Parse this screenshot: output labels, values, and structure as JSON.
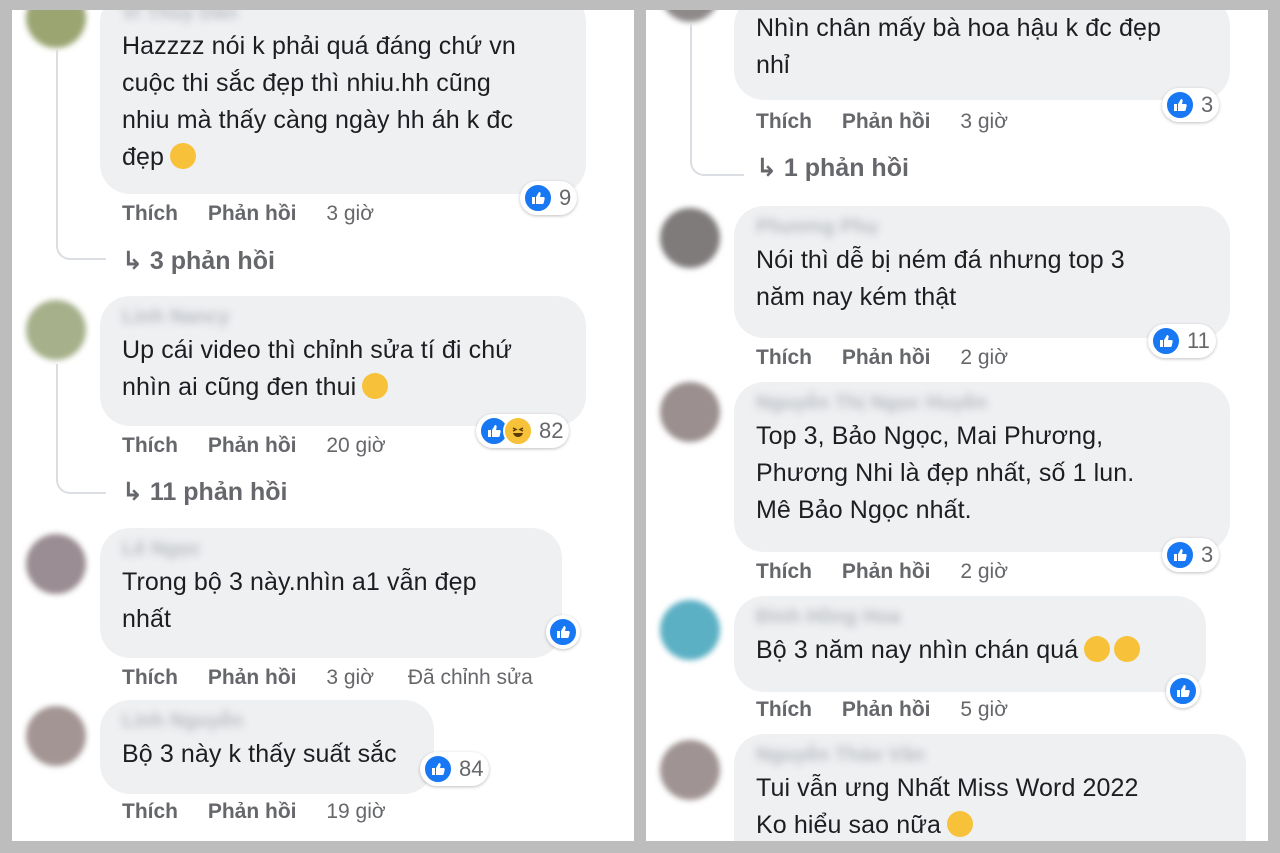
{
  "colors": {
    "like_blue": "#1877f2",
    "bubble_bg": "#eff0f2",
    "meta_gray": "#65676b"
  },
  "left_column": {
    "comments": [
      {
        "author": "Vi Thùy Dân",
        "text": "Hazzzz nói k phải quá đáng chứ vn\ncuộc thi sắc đẹp thì nhiu.hh cũng\nnhiu mà thấy càng ngày hh áh k đc\nđẹp",
        "emoji": "laughing-with-tears-emoji",
        "reaction_count": "9",
        "like_label": "Thích",
        "reply_label": "Phản hồi",
        "time": "3 giờ",
        "replies": "3 phản hồi"
      },
      {
        "author": "Linh Nancy",
        "text": "Up cái video thì chỉnh sửa tí đi chứ\nnhìn ai cũng đen thui",
        "emoji": "hugging-emoji",
        "reaction_count": "82",
        "like_label": "Thích",
        "reply_label": "Phản hồi",
        "time": "20 giờ",
        "replies": "11 phản hồi"
      },
      {
        "author": "Lê Ngọc",
        "text": "Trong bộ 3 này.nhìn a1 vẫn đẹp\nnhất",
        "reaction_count": "",
        "like_label": "Thích",
        "reply_label": "Phản hồi",
        "time": "3 giờ",
        "edited": "Đã chỉnh sửa"
      },
      {
        "author": "Linh Nguyễn",
        "text": "Bộ 3 này k thấy suất sắc",
        "reaction_count": "84",
        "like_label": "Thích",
        "reply_label": "Phản hồi",
        "time": "19 giờ"
      }
    ]
  },
  "right_column": {
    "comments": [
      {
        "text": "Nhìn chân mấy bà hoa hậu k đc đẹp\nnhỉ",
        "reaction_count": "3",
        "like_label": "Thích",
        "reply_label": "Phản hồi",
        "time": "3 giờ",
        "replies": "1 phản hồi"
      },
      {
        "author": "Phương Phụ",
        "text": "Nói thì dễ bị ném đá nhưng top 3\nnăm nay kém thật",
        "reaction_count": "11",
        "like_label": "Thích",
        "reply_label": "Phản hồi",
        "time": "2 giờ"
      },
      {
        "author": "Nguyễn Thị Ngọc Huyền",
        "text": "Top 3, Bảo Ngọc, Mai Phương,\nPhương Nhi là đẹp nhất, số 1 lun.\nMê Bảo Ngọc nhất.",
        "reaction_count": "3",
        "like_label": "Thích",
        "reply_label": "Phản hồi",
        "time": "2 giờ"
      },
      {
        "author": "Đinh Hồng Hoa",
        "text": "Bộ 3 năm nay nhìn chán quá",
        "emoji": "sad-emoji",
        "reaction_count": "",
        "like_label": "Thích",
        "reply_label": "Phản hồi",
        "time": "5 giờ"
      },
      {
        "author": "Nguyễn Thảo Vân",
        "text": "Tui vẫn ưng Nhất Miss Word 2022\nKo hiểu sao nữa",
        "emoji": "sad-emoji"
      }
    ]
  }
}
